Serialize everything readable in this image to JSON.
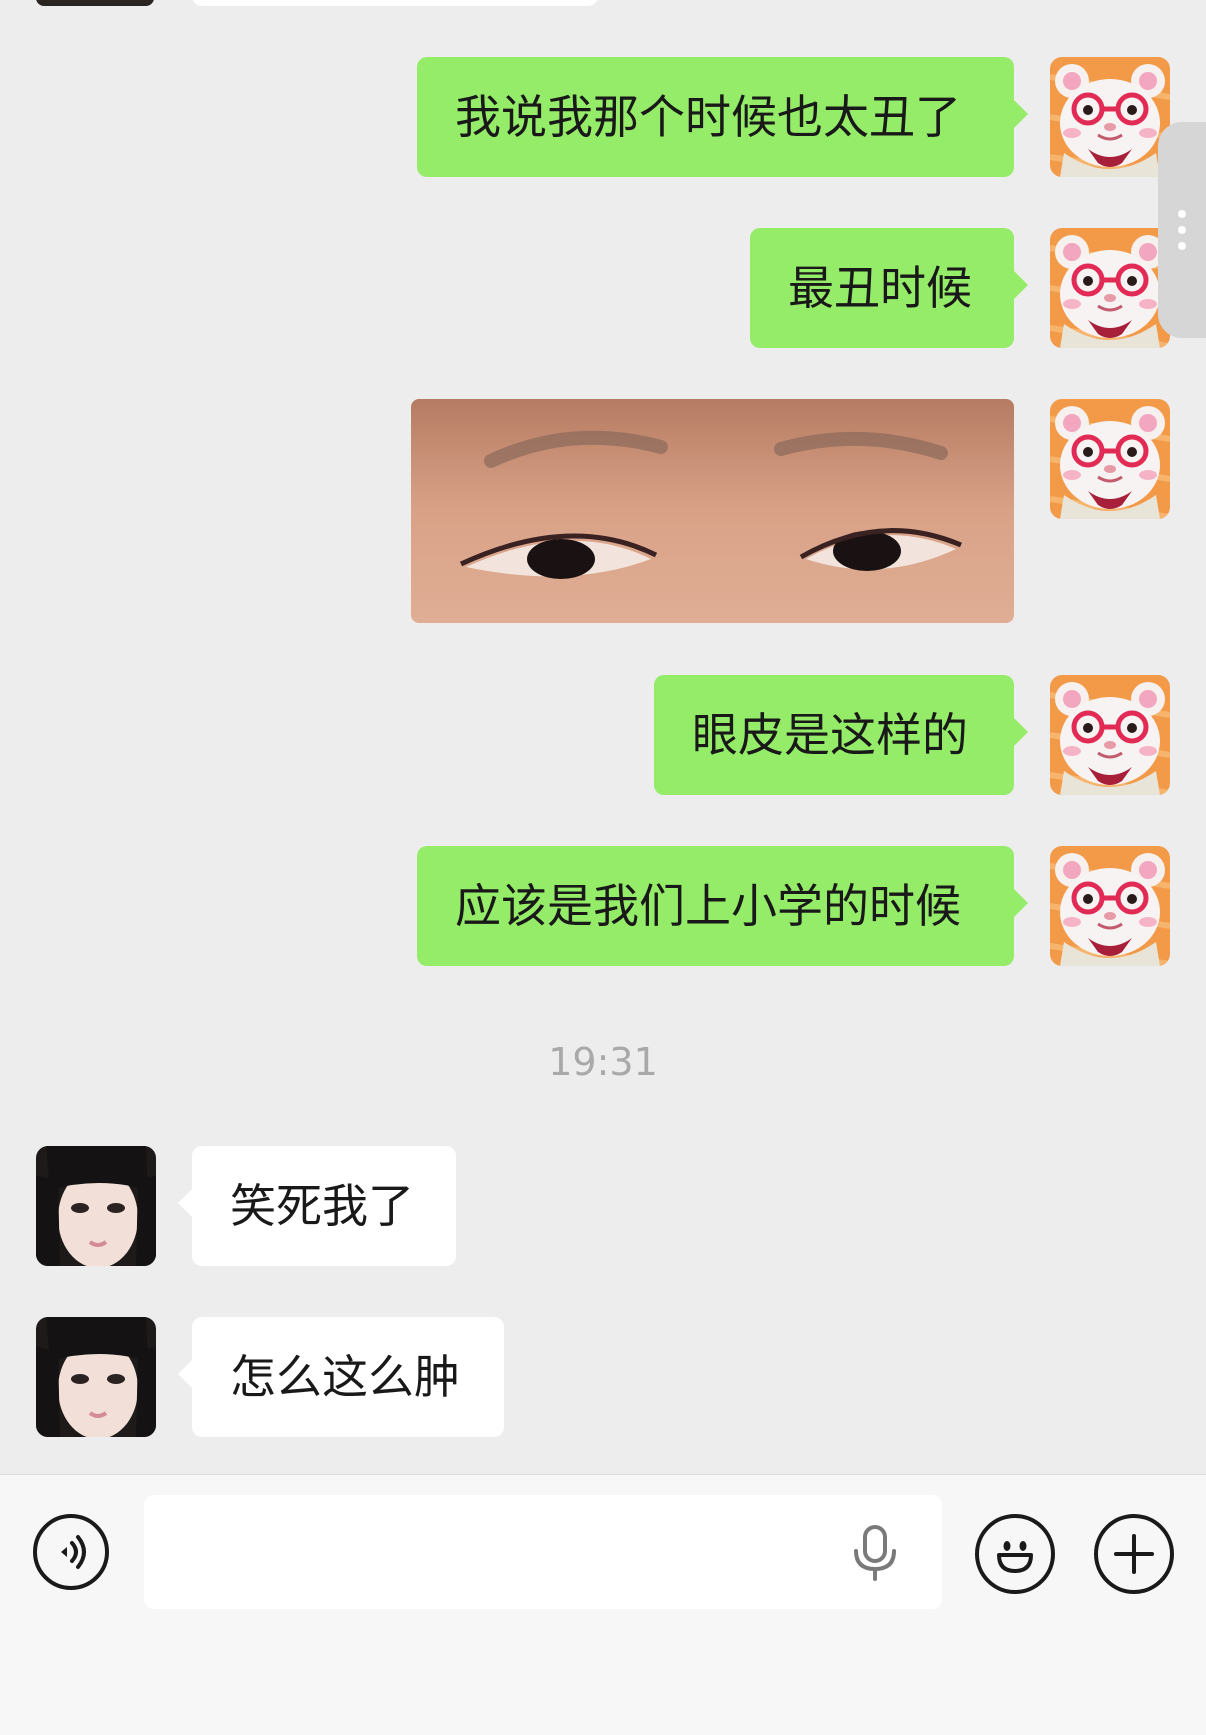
{
  "conversation": {
    "messages": [
      {
        "sender": "me",
        "type": "text",
        "text": "我说我那个时候也太丑了"
      },
      {
        "sender": "me",
        "type": "text",
        "text": "最丑时候"
      },
      {
        "sender": "me",
        "type": "image",
        "image": "close-up-eyes-photo"
      },
      {
        "sender": "me",
        "type": "text",
        "text": "眼皮是这样的"
      },
      {
        "sender": "me",
        "type": "text",
        "text": "应该是我们上小学的时候"
      },
      {
        "sender": "them",
        "type": "text",
        "text": "笑死我了"
      },
      {
        "sender": "them",
        "type": "text",
        "text": "怎么这么肿"
      }
    ],
    "timestamp": "19:31"
  },
  "input_bar": {
    "voice_icon": "voice-mode-icon",
    "placeholder": "",
    "value": "",
    "mic_icon": "microphone-icon",
    "emoji_icon": "emoji-icon",
    "plus_icon": "plus-icon"
  },
  "colors": {
    "chat_background": "#ededed",
    "my_bubble": "#95ec69",
    "their_bubble": "#ffffff",
    "timestamp_text": "#a9a9a9"
  }
}
